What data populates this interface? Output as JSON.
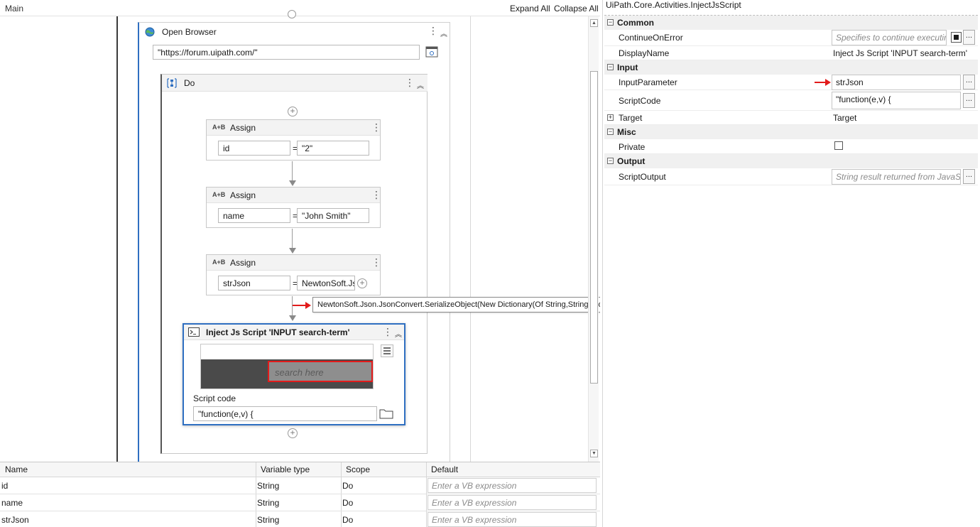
{
  "designer": {
    "tab_label": "Main",
    "expand_all": "Expand All",
    "collapse_all": "Collapse All"
  },
  "open_browser": {
    "title": "Open Browser",
    "url_value": "\"https://forum.uipath.com/\""
  },
  "do_sequence": {
    "title": "Do"
  },
  "assigns": [
    {
      "icon": "A+B",
      "title": "Assign",
      "to": "id",
      "value": "\"2\""
    },
    {
      "icon": "A+B",
      "title": "Assign",
      "to": "name",
      "value": "\"John Smith\""
    },
    {
      "icon": "A+B",
      "title": "Assign",
      "to": "strJson",
      "value": "NewtonSoft.Json"
    }
  ],
  "tooltip": {
    "text": "NewtonSoft.Json.JsonConvert.SerializeObject(New Dictionary(Of String,String)From{{\"ID\",id},{\"Name\",name}})"
  },
  "inject_js": {
    "title": "Inject Js Script 'INPUT  search-term'",
    "search_placeholder": "search here",
    "script_code_label": "Script code",
    "script_code_value": "\"function(e,v) {"
  },
  "variables": {
    "headers": {
      "name": "Name",
      "type": "Variable type",
      "scope": "Scope",
      "default": "Default"
    },
    "rows": [
      {
        "name": "id",
        "type": "String",
        "scope": "Do",
        "default_placeholder": "Enter a VB expression"
      },
      {
        "name": "name",
        "type": "String",
        "scope": "Do",
        "default_placeholder": "Enter a VB expression"
      },
      {
        "name": "strJson",
        "type": "String",
        "scope": "Do",
        "default_placeholder": "Enter a VB expression"
      }
    ]
  },
  "properties": {
    "title": "UiPath.Core.Activities.InjectJsScript",
    "categories": {
      "common": "Common",
      "input": "Input",
      "misc": "Misc",
      "output": "Output"
    },
    "continue_on_error": {
      "name": "ContinueOnError",
      "placeholder": "Specifies to continue executing"
    },
    "display_name": {
      "name": "DisplayName",
      "value": "Inject Js Script 'INPUT  search-term'"
    },
    "input_parameter": {
      "name": "InputParameter",
      "value": "strJson"
    },
    "script_code": {
      "name": "ScriptCode",
      "value": "\"function(e,v) {"
    },
    "target": {
      "name": "Target",
      "value": "Target"
    },
    "private": {
      "name": "Private"
    },
    "script_output": {
      "name": "ScriptOutput",
      "placeholder": "String result returned from JavaScript"
    },
    "ellipsis": "...",
    "toggle_minus": "−",
    "toggle_plus": "+"
  }
}
